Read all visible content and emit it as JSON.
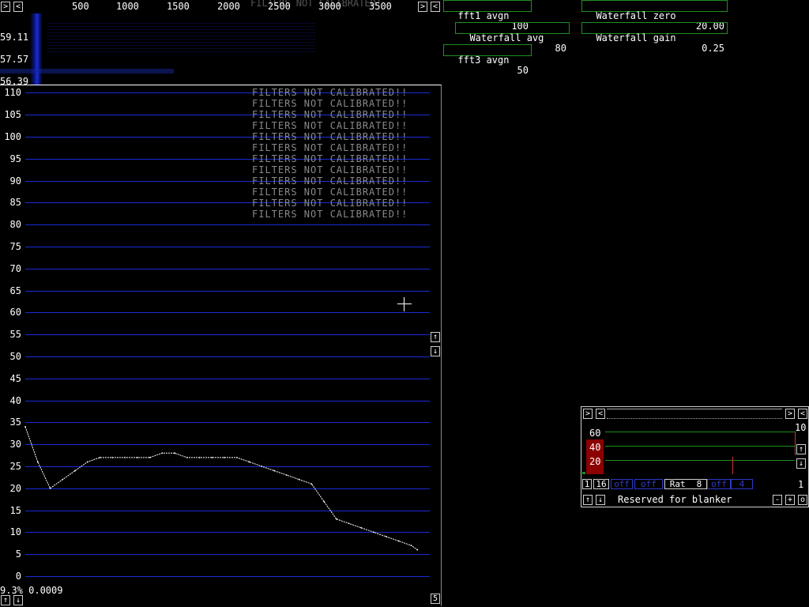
{
  "freq_ruler": {
    "ticks": [
      "500",
      "1000",
      "1500",
      "2000",
      "2500",
      "3000",
      "3500"
    ],
    "ghost": "FILTERS NOT CALIBRATED!"
  },
  "waterfall": {
    "levels": [
      "59.11",
      "57.57",
      "56.39"
    ]
  },
  "spectrum": {
    "y_ticks": [
      "110",
      "105",
      "100",
      "95",
      "90",
      "85",
      "80",
      "75",
      "70",
      "65",
      "60",
      "55",
      "50",
      "45",
      "40",
      "35",
      "30",
      "25",
      "20",
      "15",
      "10",
      "5",
      "0"
    ],
    "warning_lines": [
      "FILTERS NOT CALIBRATED!!",
      "FILTERS NOT CALIBRATED!!",
      "FILTERS NOT CALIBRATED!!",
      "FILTERS NOT CALIBRATED!!",
      "FILTERS NOT CALIBRATED!!",
      "FILTERS NOT CALIBRATED!!",
      "FILTERS NOT CALIBRATED!!",
      "FILTERS NOT CALIBRATED!!",
      "FILTERS NOT CALIBRATED!!",
      "FILTERS NOT CALIBRATED!!",
      "FILTERS NOT CALIBRATED!!",
      "FILTERS NOT CALIBRATED!!"
    ],
    "status": "9.3% 0.0009",
    "corner_btn": "5",
    "curve": [
      [
        60,
        34
      ],
      [
        64,
        26
      ],
      [
        68,
        20
      ],
      [
        72,
        22
      ],
      [
        76,
        24
      ],
      [
        80,
        26
      ],
      [
        84,
        27
      ],
      [
        88,
        27
      ],
      [
        92,
        27
      ],
      [
        96,
        27
      ],
      [
        100,
        27
      ],
      [
        104,
        28
      ],
      [
        108,
        28
      ],
      [
        112,
        27
      ],
      [
        116,
        27
      ],
      [
        120,
        27
      ],
      [
        124,
        27
      ],
      [
        128,
        27
      ],
      [
        132,
        26
      ],
      [
        136,
        25
      ],
      [
        140,
        24
      ],
      [
        144,
        23
      ],
      [
        148,
        22
      ],
      [
        152,
        21
      ],
      [
        156,
        17
      ],
      [
        160,
        13
      ],
      [
        164,
        12
      ],
      [
        168,
        11
      ],
      [
        172,
        10
      ],
      [
        176,
        9
      ],
      [
        180,
        8
      ],
      [
        184,
        7
      ],
      [
        186,
        6
      ]
    ]
  },
  "controls": {
    "fft1_avgn": {
      "label": "fft1 avgn",
      "value": "100"
    },
    "waterfall_avg": {
      "label": "Waterfall avg",
      "value": "80"
    },
    "fft3_avgn": {
      "label": "fft3 avgn",
      "value": "50"
    },
    "waterfall_zero": {
      "label": "Waterfall zero",
      "value": "20.00"
    },
    "waterfall_gain": {
      "label": "Waterfall gain",
      "value": "0.25"
    }
  },
  "blanker": {
    "scale_top": "10",
    "levels": [
      "60",
      "40",
      "20"
    ],
    "row_cells": [
      "1",
      "16",
      "off",
      "off",
      "Rat",
      "8",
      "off",
      "4"
    ],
    "right_num": "1",
    "label": "Reserved for blanker"
  },
  "colors": {
    "grid": "#1a2ad8",
    "box_border": "#1e8f1e",
    "warning": "#888888",
    "blanker_level": "#8b0000"
  }
}
